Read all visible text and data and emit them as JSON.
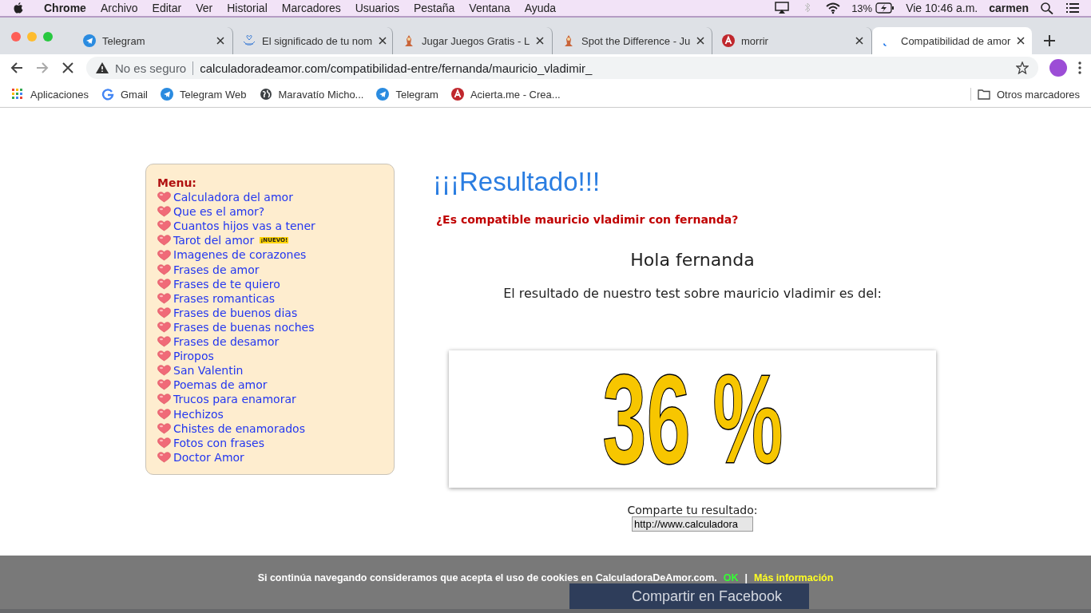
{
  "mac_menubar": {
    "app": "Chrome",
    "menus": [
      "Archivo",
      "Editar",
      "Ver",
      "Historial",
      "Marcadores",
      "Usuarios",
      "Pestaña",
      "Ventana",
      "Ayuda"
    ],
    "battery": "13%",
    "clock": "Vie 10:46 a.m.",
    "user": "carmen"
  },
  "tabs": [
    {
      "title": "Telegram",
      "kind": "telegram",
      "selected": false
    },
    {
      "title": "El significado de tu nom",
      "kind": "hands",
      "selected": false
    },
    {
      "title": "Jugar Juegos Gratis - L",
      "kind": "figure",
      "selected": false
    },
    {
      "title": "Spot the Difference - Ju",
      "kind": "figure",
      "selected": false
    },
    {
      "title": "morrir",
      "kind": "letter",
      "selected": false
    },
    {
      "title": "Compatibilidad de amor",
      "kind": "loading",
      "selected": true
    }
  ],
  "address": {
    "security": "No es seguro",
    "url": "calculadoradeamor.com/compatibilidad-entre/fernanda/mauricio_vladimir_"
  },
  "bookmarks": [
    {
      "label": "Aplicaciones",
      "kind": "apps"
    },
    {
      "label": "Gmail",
      "kind": "google"
    },
    {
      "label": "Telegram Web",
      "kind": "telegram"
    },
    {
      "label": "Maravatío Micho...",
      "kind": "globe"
    },
    {
      "label": "Telegram",
      "kind": "telegram"
    },
    {
      "label": "Acierta.me - Crea...",
      "kind": "letter"
    }
  ],
  "other_bookmarks": "Otros marcadores",
  "menu": {
    "title": "Menu:",
    "items": [
      {
        "label": "Calculadora del amor"
      },
      {
        "label": "Que es el amor?"
      },
      {
        "label": "Cuantos hijos vas a tener"
      },
      {
        "label": "Tarot del amor",
        "badge": "¡NUEVO!"
      },
      {
        "label": "Imagenes de corazones"
      },
      {
        "label": "Frases de amor"
      },
      {
        "label": "Frases de te quiero"
      },
      {
        "label": "Frases romanticas"
      },
      {
        "label": "Frases de buenos dias"
      },
      {
        "label": "Frases de buenas noches"
      },
      {
        "label": "Frases de desamor"
      },
      {
        "label": "Piropos"
      },
      {
        "label": "San Valentin"
      },
      {
        "label": "Poemas de amor"
      },
      {
        "label": "Trucos para enamorar"
      },
      {
        "label": "Hechizos"
      },
      {
        "label": "Chistes de enamorados"
      },
      {
        "label": "Fotos con frases"
      },
      {
        "label": "Doctor Amor"
      }
    ]
  },
  "result": {
    "heading": "¡¡¡Resultado!!!",
    "question": "¿Es compatible mauricio vladimir con fernanda?",
    "greeting": "Hola fernanda",
    "sentence": "El resultado de nuestro test sobre mauricio vladimir es del:",
    "percent": "36 %",
    "share_label": "Comparte tu resultado:",
    "share_url": "http://www.calculadora",
    "facebook_button": "Compartir en Facebook"
  },
  "cookie_banner": {
    "text": "Si continúa navegando consideramos que acepta el uso de cookies en CalculadoraDeAmor.com.",
    "ok": "OK",
    "separator": "|",
    "more": "Más información"
  }
}
